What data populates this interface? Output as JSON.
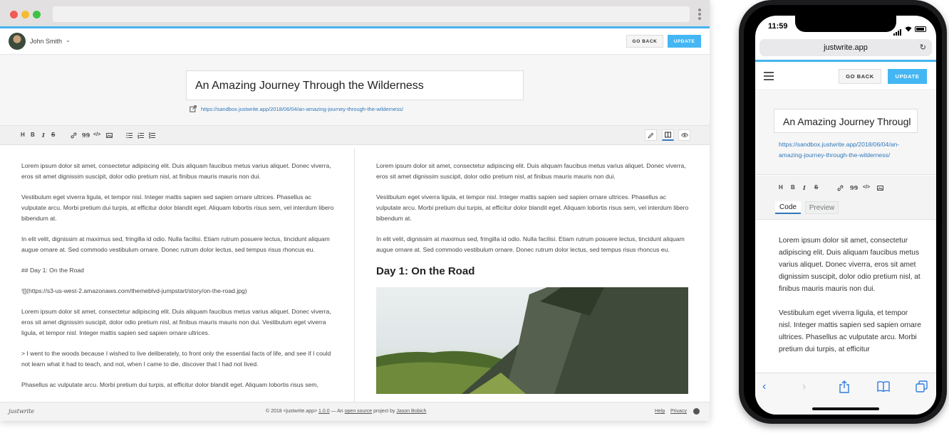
{
  "desktop": {
    "user": {
      "name": "John Smith"
    },
    "buttons": {
      "go_back": "GO BACK",
      "update": "UPDATE"
    },
    "post": {
      "title": "An Amazing Journey Through the Wilderness",
      "permalink": "https://sandbox.justwrite.app/2018/06/04/an-amazing-journey-through-the-wilderness/"
    },
    "toolbar": {
      "h": "H",
      "b": "B",
      "i": "I",
      "s": "S",
      "quote": "99",
      "code": "</>"
    },
    "editor": {
      "p1": "Lorem ipsum dolor sit amet, consectetur adipiscing elit. Duis aliquam faucibus metus varius aliquet. Donec viverra, eros sit amet dignissim suscipit, dolor odio pretium nisl, at finibus mauris mauris non dui.",
      "p2": "Vestibulum eget viverra ligula, et tempor nisl. Integer mattis sapien sed sapien ornare ultrices. Phasellus ac vulputate arcu. Morbi pretium dui turpis, at efficitur dolor blandit eget. Aliquam lobortis risus sem, vel interdum libero bibendum at.",
      "p3": "In elit velit, dignissim at maximus sed, fringilla id odio. Nulla facilisi. Etiam rutrum posuere lectus, tincidunt aliquam augue ornare at. Sed commodo vestibulum ornare. Donec rutrum dolor lectus, sed tempus risus rhoncus eu.",
      "heading": "## Day 1: On the Road",
      "image": "![](https://s3-us-west-2.amazonaws.com/themeblvd-jumpstart/story/on-the-road.jpg)",
      "p4": "Lorem ipsum dolor sit amet, consectetur adipiscing elit. Duis aliquam faucibus metus varius aliquet. Donec viverra, eros sit amet dignissim suscipit, dolor odio pretium nisl, at finibus mauris mauris non dui. Vestibulum eget viverra ligula, et tempor nisl. Integer mattis sapien sed sapien ornare ultrices.",
      "quote": "> I went to the woods because I wished to live deliberately, to front only the essential facts of life, and see if I could not learn what it had to teach, and not, when I came to die, discover that I had not lived.",
      "p5": "Phasellus ac vulputate arcu. Morbi pretium dui turpis, at efficitur dolor blandit eget. Aliquam lobortis risus sem,"
    },
    "preview": {
      "p1": "Lorem ipsum dolor sit amet, consectetur adipiscing elit. Duis aliquam faucibus metus varius aliquet. Donec viverra, eros sit amet dignissim suscipit, dolor odio pretium nisl, at finibus mauris mauris non dui.",
      "p2": "Vestibulum eget viverra ligula, et tempor nisl. Integer mattis sapien sed sapien ornare ultrices. Phasellus ac vulputate arcu. Morbi pretium dui turpis, at efficitur dolor blandit eget. Aliquam lobortis risus sem, vel interdum libero bibendum at.",
      "p3": "In elit velit, dignissim at maximus sed, fringilla id odio. Nulla facilisi. Etiam rutrum posuere lectus, tincidunt aliquam augue ornare at. Sed commodo vestibulum ornare. Donec rutrum dolor lectus, sed tempus risus rhoncus eu.",
      "heading": "Day 1: On the Road"
    },
    "footer": {
      "brand": "justwrite",
      "copyright_prefix": "© 2018 <justwrite.app> ",
      "version": "1.0.0",
      "copyright_mid": " — An ",
      "open_source": "open source",
      "copyright_by": " project by ",
      "author": "Jason Bobich",
      "help": "Help",
      "privacy": "Privacy"
    }
  },
  "mobile": {
    "time": "11:59",
    "url": "justwrite.app",
    "buttons": {
      "go_back": "GO BACK",
      "update": "UPDATE"
    },
    "title": "An Amazing Journey Througl",
    "permalink": "https://sandbox.justwrite.app/2018/06/04/an-amazing-journey-through-the-wilderness/",
    "tabs": {
      "code": "Code",
      "preview": "Preview"
    },
    "content": {
      "p1": "Lorem ipsum dolor sit amet, consectetur adipiscing elit. Duis aliquam faucibus metus varius aliquet. Donec viverra, eros sit amet dignissim suscipit, dolor odio pretium nisl, at finibus mauris mauris non dui.",
      "p2": "Vestibulum eget viverra ligula, et tempor nisl. Integer mattis sapien sed sapien ornare ultrices. Phasellus ac vulputate arcu. Morbi pretium dui turpis, at efficitur"
    }
  },
  "colors": {
    "accent": "#44b6f3",
    "link": "#2f78b8"
  }
}
